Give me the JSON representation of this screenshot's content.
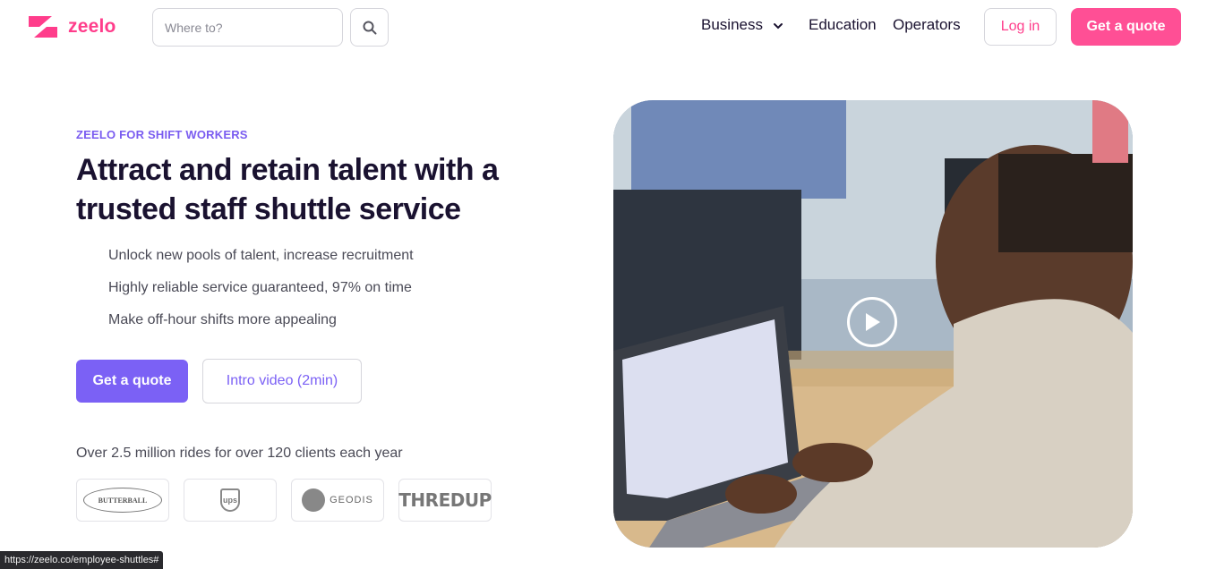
{
  "brand": {
    "name": "zeelo",
    "primary_color": "#ff3d8b",
    "accent_color": "#7b61f5"
  },
  "header": {
    "search": {
      "placeholder": "Where to?",
      "value": "",
      "button_icon": "search-icon"
    },
    "nav": [
      {
        "label": "Business",
        "has_dropdown": true
      },
      {
        "label": "Education"
      },
      {
        "label": "Operators"
      }
    ],
    "login_label": "Log in",
    "quote_label": "Get a quote"
  },
  "hero": {
    "eyebrow": "ZEELO FOR SHIFT WORKERS",
    "headline": "Attract and retain talent with a trusted staff shuttle service",
    "bullets": [
      "Unlock new pools of talent, increase recruitment",
      "Highly reliable service guaranteed, 97% on time",
      "Make off-hour shifts more appealing"
    ],
    "primary_cta": "Get a quote",
    "secondary_cta": "Intro video (2min)",
    "rides_text": "Over 2.5 million rides for over 120 clients each year",
    "clients": [
      {
        "name": "BUTTERBALL"
      },
      {
        "name": "ups"
      },
      {
        "name": "GEODIS"
      },
      {
        "name": "THREDUP"
      }
    ],
    "media": {
      "play_icon": "play-icon"
    }
  },
  "status_bar": {
    "url": "https://zeelo.co/employee-shuttles#"
  }
}
